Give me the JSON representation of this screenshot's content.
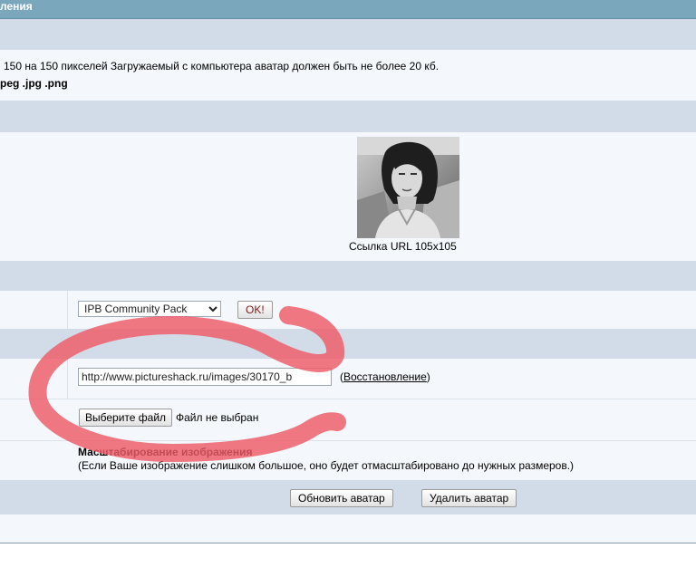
{
  "header": {
    "title": "ления"
  },
  "info": {
    "size_text": "150 на 150 пикселей Загружаемый с компьютера аватар должен быть не более 20 кб.",
    "formats": "peg .jpg .png"
  },
  "avatar": {
    "caption": "Ссылка URL 105x105",
    "icon": "portrait-photo"
  },
  "gallery": {
    "selected": "IPB Community Pack",
    "options": [
      "IPB Community Pack"
    ],
    "ok_label": "OK!"
  },
  "url_field": {
    "value": "http://www.pictureshack.ru/images/30170_b",
    "restore_prefix": "(",
    "restore_link": "Восстановление",
    "restore_suffix": ")"
  },
  "file_upload": {
    "button_label": "Выберите файл",
    "status": "Файл не выбран"
  },
  "scaling": {
    "title": "Масштабирование изображения",
    "description": "(Если Ваше изображение слишком большое, оно будет отмасштабировано до нужных размеров.)"
  },
  "actions": {
    "update_label": "Обновить аватар",
    "delete_label": "Удалить аватар"
  },
  "colors": {
    "header_bg": "#7ba7bd",
    "band_bg": "#d2dce8",
    "row_bg": "#f4f7fb",
    "annotation_stroke": "#ee5a66"
  }
}
